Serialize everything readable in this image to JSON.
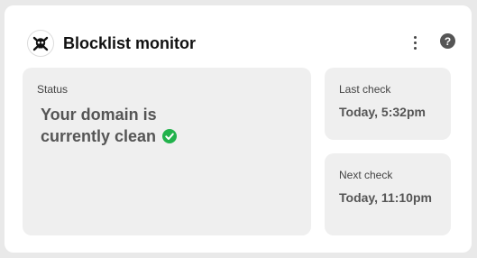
{
  "widget": {
    "title": "Blocklist monitor",
    "logo_icon": "skull-crossbones-icon",
    "menu_icon": "more-vertical-icon",
    "help_icon": "help-circle-icon",
    "help_glyph": "?"
  },
  "status": {
    "label": "Status",
    "value": "Your domain is currently clean",
    "icon": "check-circle-icon",
    "icon_color": "#22b24c"
  },
  "last_check": {
    "label": "Last check",
    "value": "Today, 5:32pm"
  },
  "next_check": {
    "label": "Next check",
    "value": "Today, 11:10pm"
  }
}
